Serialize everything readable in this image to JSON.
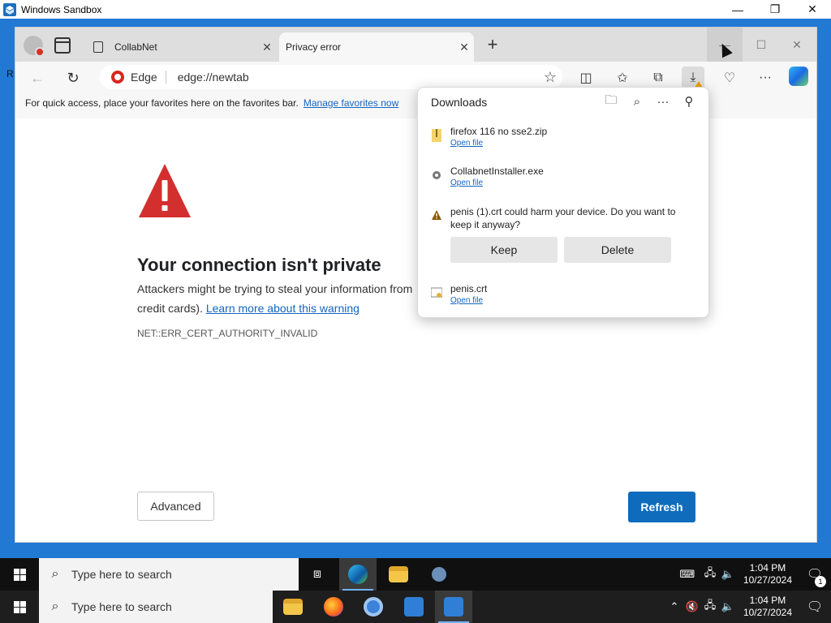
{
  "sandbox": {
    "title": "Windows Sandbox",
    "controls": [
      "minimize",
      "restore",
      "close"
    ]
  },
  "host_left_char": "R",
  "edge": {
    "tabs": [
      {
        "label": "CollabNet",
        "active": false
      },
      {
        "label": "Privacy error",
        "active": true
      }
    ],
    "address": {
      "site_label": "Edge",
      "url": "edge://newtab"
    },
    "favbar": {
      "text": "For quick access, place your favorites here on the favorites bar.",
      "link": "Manage favorites now"
    },
    "error": {
      "title": "Your connection isn't private",
      "body_start": "Attackers might be trying to steal your information from",
      "body_cont": "credit cards).",
      "learn_more": "Learn more about this warning",
      "code": "NET::ERR_CERT_AUTHORITY_INVALID",
      "advanced_label": "Advanced",
      "refresh_label": "Refresh"
    },
    "downloads": {
      "title": "Downloads",
      "items": [
        {
          "name": "firefox 116 no sse2.zip",
          "action": "Open file",
          "icon": "zip-icon"
        },
        {
          "name": "CollabnetInstaller.exe",
          "action": "Open file",
          "icon": "exe-icon"
        },
        {
          "warning": "penis (1).crt could harm your device. Do you want to keep it anyway?",
          "keep": "Keep",
          "delete": "Delete",
          "icon": "warning-icon"
        },
        {
          "name": "penis.crt",
          "action": "Open file",
          "icon": "cert-icon"
        }
      ]
    },
    "colors": {
      "accent": "#0f6cbd",
      "warning_red": "#d32f2f"
    }
  },
  "taskbar_sandbox": {
    "search_placeholder": "Type here to search",
    "time": "1:04 PM",
    "date": "10/27/2024",
    "notification_count": "1"
  },
  "taskbar_host": {
    "search_placeholder": "Type here to search",
    "time": "1:04 PM",
    "date": "10/27/2024"
  }
}
